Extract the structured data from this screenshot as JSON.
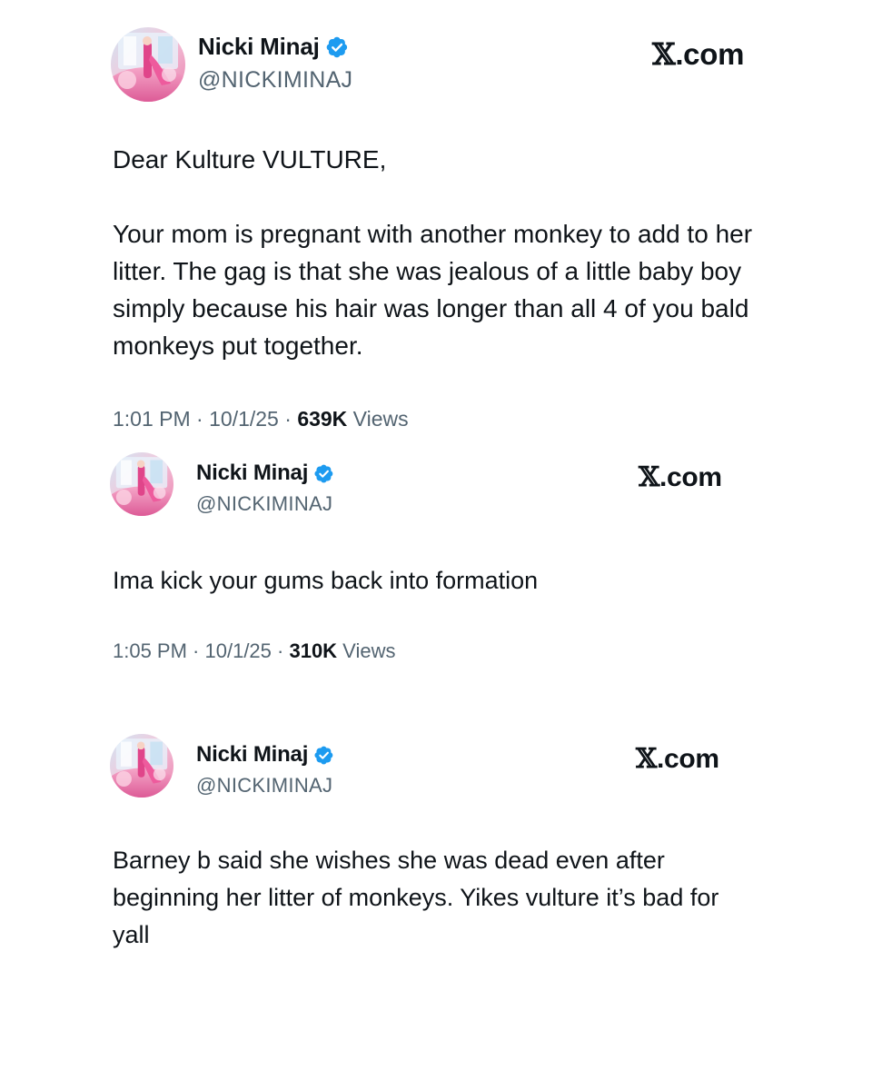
{
  "brand": {
    "verified_color": "#1d9bf0",
    "text_color": "#0f1419",
    "muted_color": "#536471"
  },
  "tweets": [
    {
      "author": {
        "display_name": "Nicki Minaj",
        "handle": "@NICKIMINAJ",
        "verified": true,
        "avatar_icon": "avatar-photo",
        "badge_icon": "verified-badge-icon"
      },
      "site_label": {
        "logo": "𝕏",
        "suffix": ".com"
      },
      "text": {
        "greeting": "Dear Kulture VULTURE,",
        "body": "Your mom is pregnant with another monkey to add to her litter. The gag is that she was jealous of a little baby boy simply because his hair was longer than all 4 of you bald monkeys put together."
      },
      "meta": {
        "time": "1:01 PM",
        "sep1": " · ",
        "date": "10/1/25",
        "sep2": " · ",
        "views_count": "639K",
        "views_label": " Views"
      }
    },
    {
      "author": {
        "display_name": "Nicki Minaj",
        "handle": "@NICKIMINAJ",
        "verified": true,
        "avatar_icon": "avatar-photo",
        "badge_icon": "verified-badge-icon"
      },
      "site_label": {
        "logo": "𝕏",
        "suffix": ".com"
      },
      "text": {
        "body": "Ima kick your gums back into formation"
      },
      "meta": {
        "time": "1:05 PM",
        "sep1": " · ",
        "date": "10/1/25",
        "sep2": " · ",
        "views_count": "310K",
        "views_label": " Views"
      }
    },
    {
      "author": {
        "display_name": "Nicki Minaj",
        "handle": "@NICKIMINAJ",
        "verified": true,
        "avatar_icon": "avatar-photo",
        "badge_icon": "verified-badge-icon"
      },
      "site_label": {
        "logo": "𝕏",
        "suffix": ".com"
      },
      "text": {
        "body": "Barney b said she wishes she was dead even after beginning her litter of monkeys. Yikes vulture it’s bad for yall"
      }
    }
  ]
}
